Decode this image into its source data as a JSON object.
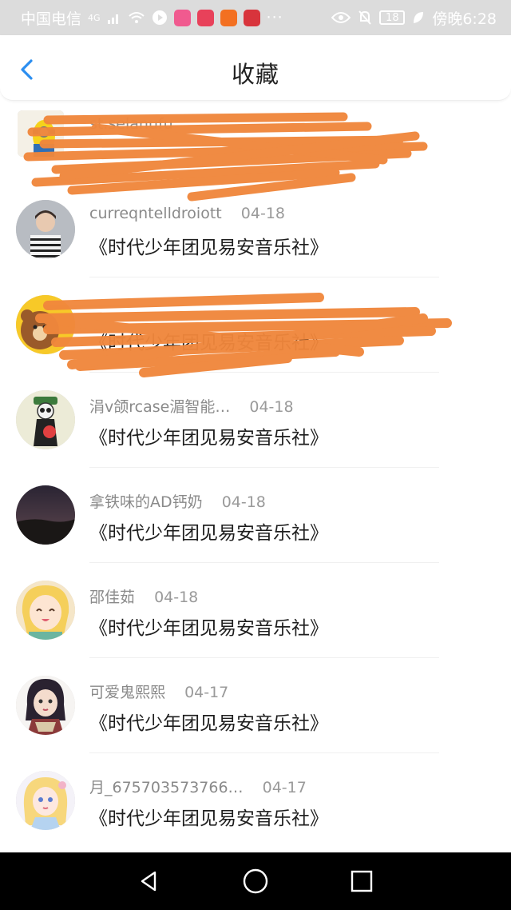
{
  "status_bar": {
    "carrier": "中国电信",
    "network": "4G",
    "battery": "18",
    "time": "傍晚6:28",
    "more": "···"
  },
  "header": {
    "title": "收藏"
  },
  "items": [
    {
      "name": "st.selanufu",
      "date": "",
      "content": ""
    },
    {
      "name": "curreqntelldroiott",
      "date": "04-18",
      "content": "《时代少年团见易安音乐社》"
    },
    {
      "name": "",
      "date": "",
      "content": "《时代少年团见易安音乐社》"
    },
    {
      "name": "涓v颌rcase湄智能…",
      "date": "04-18",
      "content": "《时代少年团见易安音乐社》"
    },
    {
      "name": "拿铁味的AD钙奶",
      "date": "04-18",
      "content": "《时代少年团见易安音乐社》"
    },
    {
      "name": "邵佳茹",
      "date": "04-18",
      "content": "《时代少年团见易安音乐社》"
    },
    {
      "name": "可爱鬼熙熙",
      "date": "04-17",
      "content": "《时代少年团见易安音乐社》"
    },
    {
      "name": "月_675703573766…",
      "date": "04-17",
      "content": "《时代少年团见易安音乐社》"
    }
  ],
  "colors": {
    "accent": "#2b8ef0",
    "redaction": "#f0873c",
    "status_bar_bg": "#dcdcdc",
    "nav_bar_bg": "#000000"
  },
  "icons": {
    "back": "chevron-left-icon",
    "nav_back": "triangle-back-icon",
    "nav_home": "circle-home-icon",
    "nav_recent": "square-recent-icon"
  }
}
